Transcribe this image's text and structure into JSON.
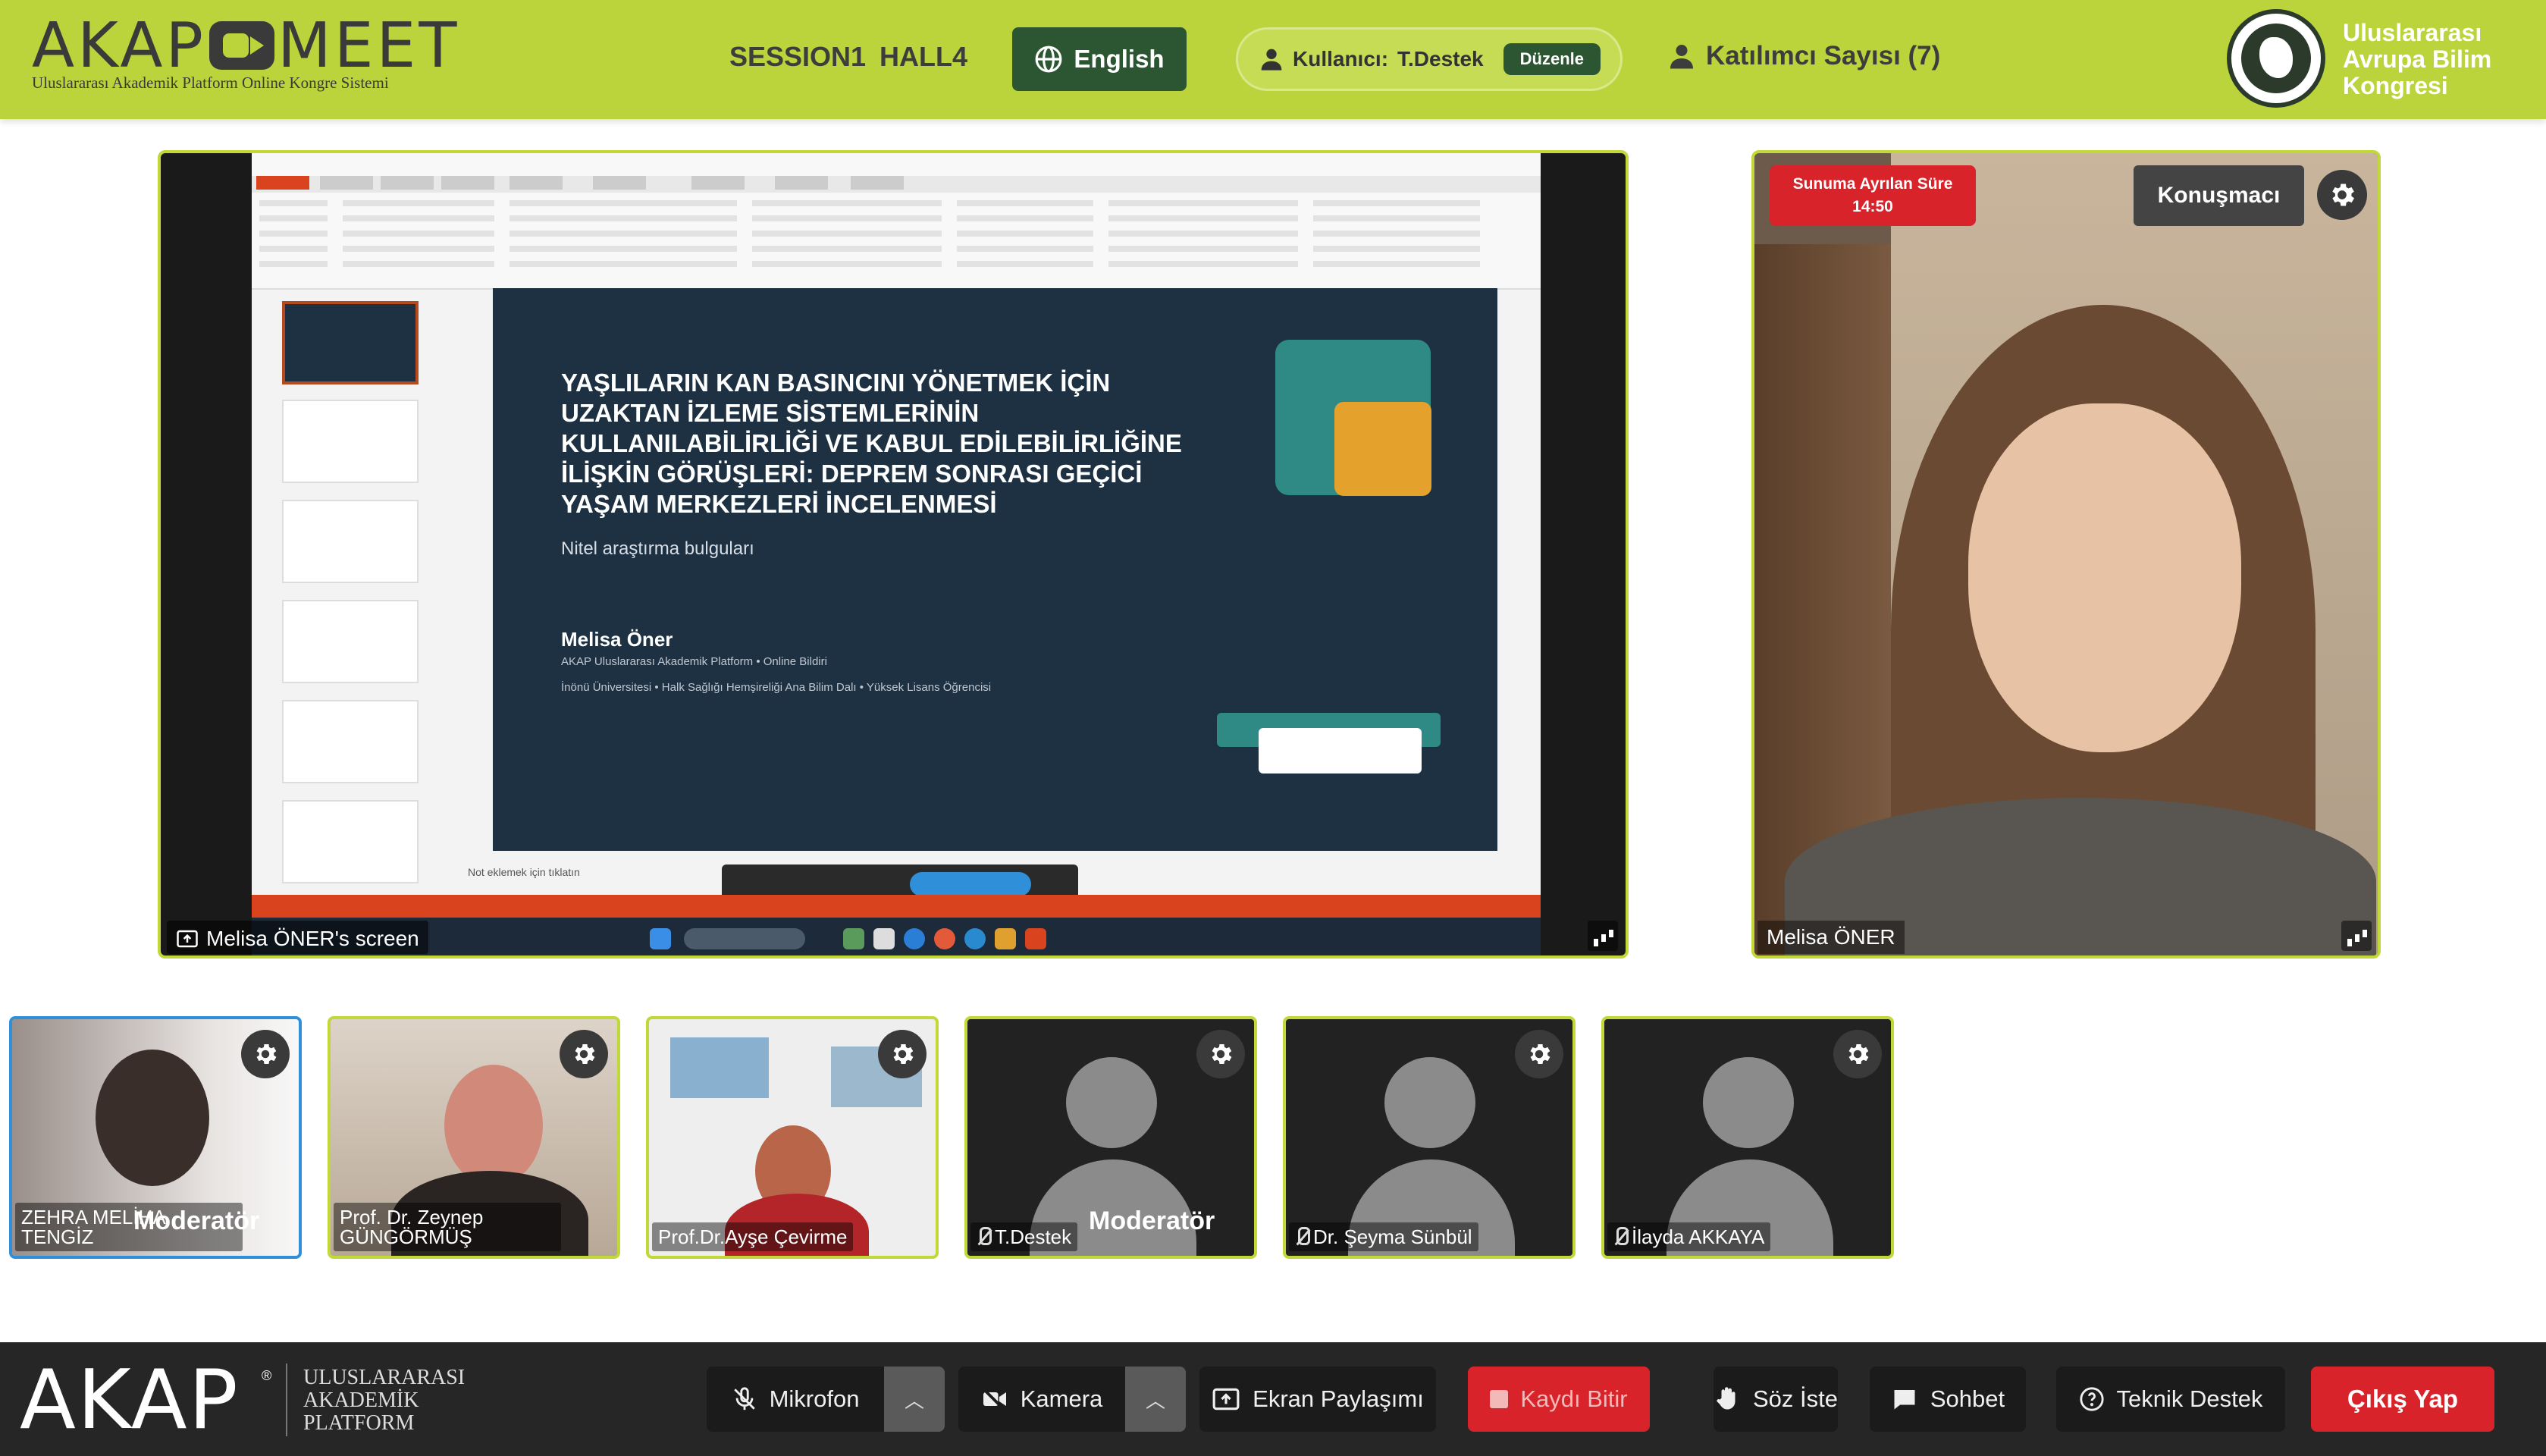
{
  "header": {
    "logo_left": "AKAP",
    "logo_right": "MEET",
    "logo_subtitle": "Uluslararası Akademik Platform Online Kongre Sistemi",
    "session": "SESSION1",
    "hall": "HALL4",
    "language": "English",
    "user_label": "Kullanıcı:",
    "user_name": "T.Destek",
    "edit_label": "Düzenle",
    "participants_label": "Katılımcı Sayısı (7)",
    "congress_name": "Uluslararası Avrupa Bilim Kongresi"
  },
  "screen_share": {
    "label": "Melisa ÖNER's screen",
    "slide": {
      "title": "YAŞLILARIN KAN BASINCINI YÖNETMEK İÇİN UZAKTAN İZLEME SİSTEMLERİNİN KULLANILABİLİRLİĞİ VE KABUL EDİLEBİLİRLİĞİNE İLİŞKİN GÖRÜŞLERİ: DEPREM SONRASI GEÇİCİ YAŞAM MERKEZLERİ İNCELENMESİ",
      "subtitle": "Nitel araştırma bulguları",
      "author": "Melisa Öner",
      "affiliation_1": "AKAP Uluslararası Akademik Platform • Online Bildiri",
      "affiliation_2": "İnönü Üniversitesi • Halk Sağlığı Hemşireliği Ana Bilim Dalı • Yüksek Lisans Öğrencisi",
      "notes": "Not eklemek için tıklatın"
    }
  },
  "speaker": {
    "timer_label": "Sunuma Ayrılan Süre",
    "timer_value": "14:50",
    "role": "Konuşmacı",
    "name": "Melisa ÖNER"
  },
  "participants": [
    {
      "name": "ZEHRA MELİHA TENGİZ",
      "badge": "Moderatör"
    },
    {
      "name": "Prof. Dr. Zeynep GÜNGÖRMÜŞ",
      "badge": ""
    },
    {
      "name": "Prof.Dr.Ayşe Çevirme",
      "badge": ""
    },
    {
      "name": "T.Destek",
      "badge": "Moderatör"
    },
    {
      "name": "Dr. Şeyma Sünbül",
      "badge": ""
    },
    {
      "name": "İlayda AKKAYA",
      "badge": ""
    }
  ],
  "bottom_bar": {
    "logo": "AKAP",
    "logo_words": [
      "ULUSLARARASI",
      "AKADEMİK",
      "PLATFORM"
    ],
    "mic": "Mikrofon",
    "camera": "Kamera",
    "screen_share": "Ekran Paylaşımı",
    "record": "Kaydı Bitir",
    "raise_hand": "Söz İste",
    "chat": "Sohbet",
    "support": "Teknik Destek",
    "leave": "Çıkış Yap"
  },
  "colors": {
    "header_green": "#bcd43c",
    "dark_green": "#2c5631",
    "red": "#d9232a",
    "bar_dark": "#262626"
  }
}
